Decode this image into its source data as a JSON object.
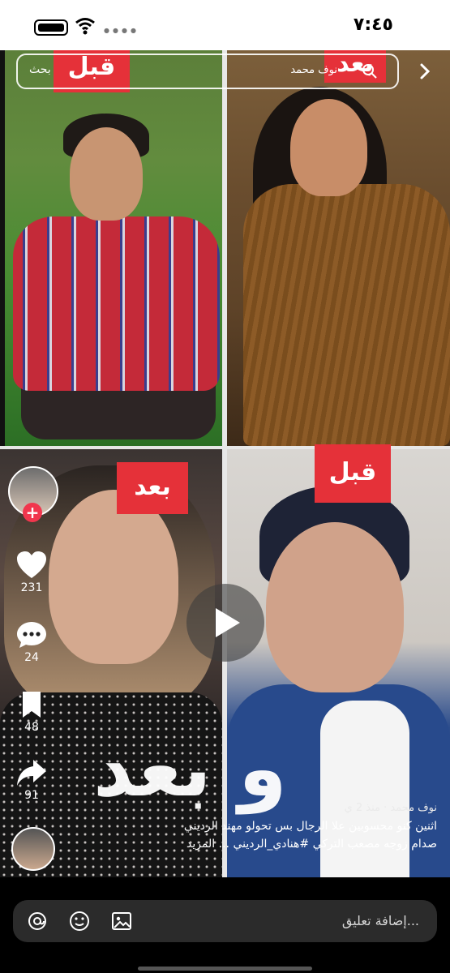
{
  "status_bar": {
    "time": "٧:٤٥"
  },
  "search": {
    "label": "بحث",
    "query": "نوف محمد"
  },
  "captions": {
    "before": "قبل",
    "after": "بعد",
    "overlay": "و بعد"
  },
  "stats": {
    "likes": "231",
    "comments": "24",
    "saves": "48",
    "shares": "91"
  },
  "post": {
    "author": "نوف محمد",
    "time": "منذ 2 ي",
    "line1": "اثنين كنو محسوبين علا الرجال بس  تحولو مهند الرديني",
    "line2": "صدام زوجه مصعب التركي #هنادي_الرديني ... المزيد"
  },
  "comment": {
    "placeholder": "إضافة تعليق..."
  }
}
